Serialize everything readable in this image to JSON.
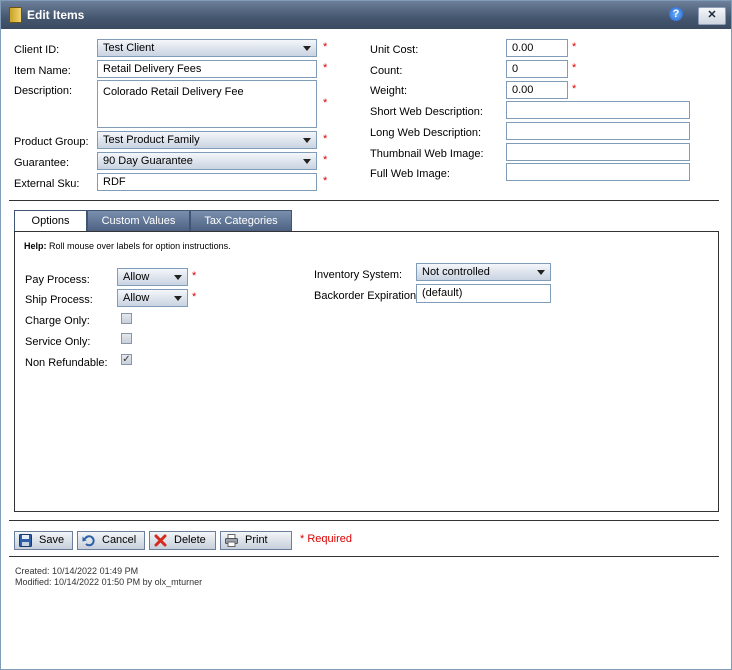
{
  "window": {
    "title": "Edit Items"
  },
  "left_form": {
    "client_id_label": "Client ID:",
    "client_id_value": "Test Client",
    "item_name_label": "Item Name:",
    "item_name_value": "Retail Delivery Fees",
    "description_label": "Description:",
    "description_value": "Colorado Retail Delivery Fee",
    "product_group_label": "Product Group:",
    "product_group_value": "Test Product Family",
    "guarantee_label": "Guarantee:",
    "guarantee_value": "90 Day Guarantee",
    "external_sku_label": "External Sku:",
    "external_sku_value": "RDF"
  },
  "right_form": {
    "unit_cost_label": "Unit Cost:",
    "unit_cost_value": "0.00",
    "count_label": "Count:",
    "count_value": "0",
    "weight_label": "Weight:",
    "weight_value": "0.00",
    "short_web_label": "Short Web Description:",
    "short_web_value": "",
    "long_web_label": "Long Web Description:",
    "long_web_value": "",
    "thumb_label": "Thumbnail Web Image:",
    "thumb_value": "",
    "full_label": "Full Web Image:",
    "full_value": ""
  },
  "required_marker": "*",
  "tabs": [
    {
      "label": "Options",
      "active": true
    },
    {
      "label": "Custom Values",
      "active": false
    },
    {
      "label": "Tax Categories",
      "active": false
    }
  ],
  "options": {
    "help_bold": "Help:",
    "help_text": "Roll mouse over labels for option instructions.",
    "pay_process_label": "Pay Process:",
    "pay_process_value": "Allow",
    "ship_process_label": "Ship Process:",
    "ship_process_value": "Allow",
    "charge_only_label": "Charge Only:",
    "charge_only_checked": false,
    "service_only_label": "Service Only:",
    "service_only_checked": false,
    "non_refundable_label": "Non Refundable:",
    "non_refundable_checked": true,
    "inventory_label": "Inventory System:",
    "inventory_value": "Not controlled",
    "backorder_label": "Backorder Expiration:",
    "backorder_value": "(default)"
  },
  "buttons": {
    "save": "Save",
    "cancel": "Cancel",
    "delete": "Delete",
    "print": "Print",
    "required_note": "* Required"
  },
  "meta": {
    "created": "Created:  10/14/2022 01:49 PM",
    "modified": "Modified:  10/14/2022 01:50 PM by olx_mturner"
  },
  "colors": {
    "titlebar": "#45566f",
    "tab_inactive": "#4d6282",
    "required": "#dd0000",
    "border": "#7f9db9"
  }
}
